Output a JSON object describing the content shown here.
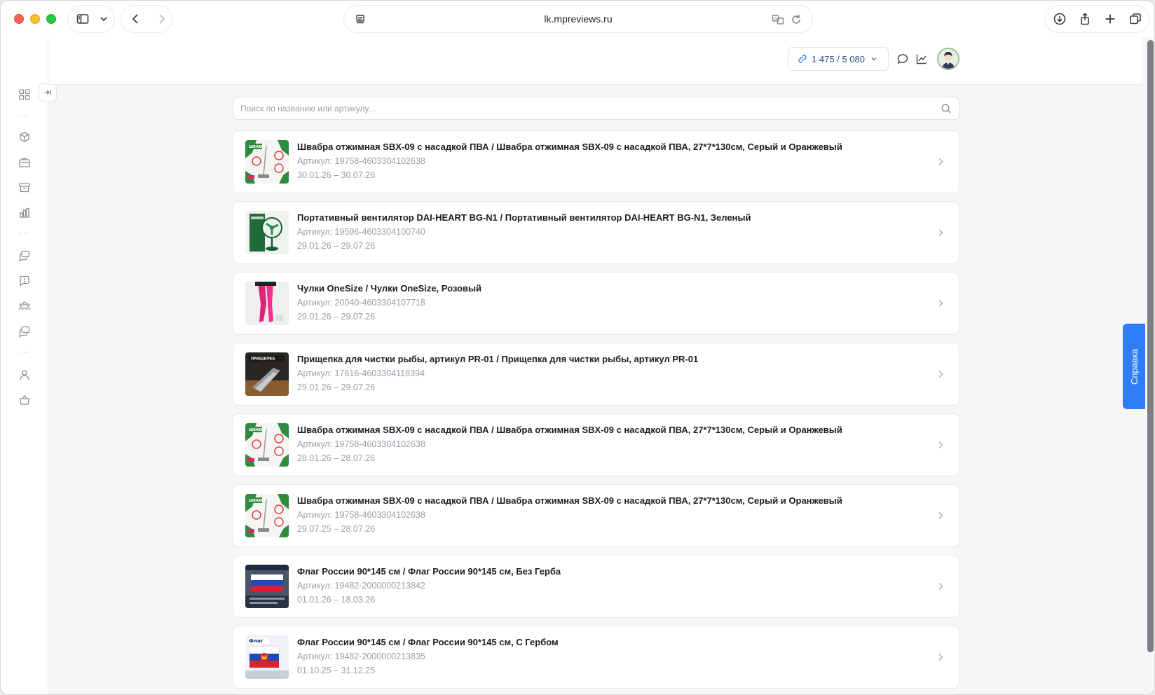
{
  "browser": {
    "url": "lk.mpreviews.ru"
  },
  "header": {
    "quota": "1 475 / 5 080"
  },
  "search": {
    "placeholder": "Поиск по названию или артикулу..."
  },
  "items": [
    {
      "title": "Швабра отжимная SBX-09 с насадкой ПВА / Швабра отжимная SBX-09 с насадкой ПВА, 27*7*130см, Серый и Оранжевый",
      "sku": "Артикул: 19758-4603304102638",
      "dates": "30.01.26 – 30.07.26",
      "thumb": "mop"
    },
    {
      "title": "Портативный вентилятор DAI-HEART BG-N1 / Портативный вентилятор DAI-HEART BG-N1, Зеленый",
      "sku": "Артикул: 19596-4603304100740",
      "dates": "29.01.26 – 29.07.26",
      "thumb": "fan"
    },
    {
      "title": "Чулки OneSize / Чулки OneSize, Розовый",
      "sku": "Артикул: 20040-4603304107718",
      "dates": "29.01.26 – 29.07.26",
      "thumb": "stockings"
    },
    {
      "title": "Прищепка для чистки рыбы, артикул PR-01 / Прищепка для чистки рыбы, артикул PR-01",
      "sku": "Артикул: 17616-4603304118394",
      "dates": "29.01.26 – 29.07.26",
      "thumb": "clip"
    },
    {
      "title": "Швабра отжимная SBX-09 с насадкой ПВА / Швабра отжимная SBX-09 с насадкой ПВА, 27*7*130см, Серый и Оранжевый",
      "sku": "Артикул: 19758-4603304102638",
      "dates": "28.01.26 – 28.07.26",
      "thumb": "mop"
    },
    {
      "title": "Швабра отжимная SBX-09 с насадкой ПВА / Швабра отжимная SBX-09 с насадкой ПВА, 27*7*130см, Серый и Оранжевый",
      "sku": "Артикул: 19758-4603304102638",
      "dates": "29.07.25 – 28.07.26",
      "thumb": "mop"
    },
    {
      "title": "Флаг России 90*145 см / Флаг России 90*145 см, Без Герба",
      "sku": "Артикул: 19482-2000000213842",
      "dates": "01.01.26 – 18.03.26",
      "thumb": "flag"
    },
    {
      "title": "Флаг России 90*145 см / Флаг России 90*145 см, С Гербом",
      "sku": "Артикул: 19482-2000000213835",
      "dates": "01.10.25 – 31.12.25",
      "thumb": "flag-coat"
    }
  ],
  "help_tab": "Справка",
  "colors": {
    "accent": "#2f7df6",
    "quota_text": "#2b4e8c"
  },
  "icons": {
    "sidebar": [
      "dashboard-icon",
      "cubes-icon",
      "briefcase-icon",
      "archive-icon",
      "bar-chart-icon",
      "chat-stack-icon",
      "question-bubble-icon",
      "users-group-icon",
      "chat-stack-icon",
      "person-icon",
      "basket-icon"
    ],
    "header": [
      "link-icon",
      "chevron-down-icon",
      "comment-icon",
      "line-chart-icon",
      "avatar"
    ]
  }
}
